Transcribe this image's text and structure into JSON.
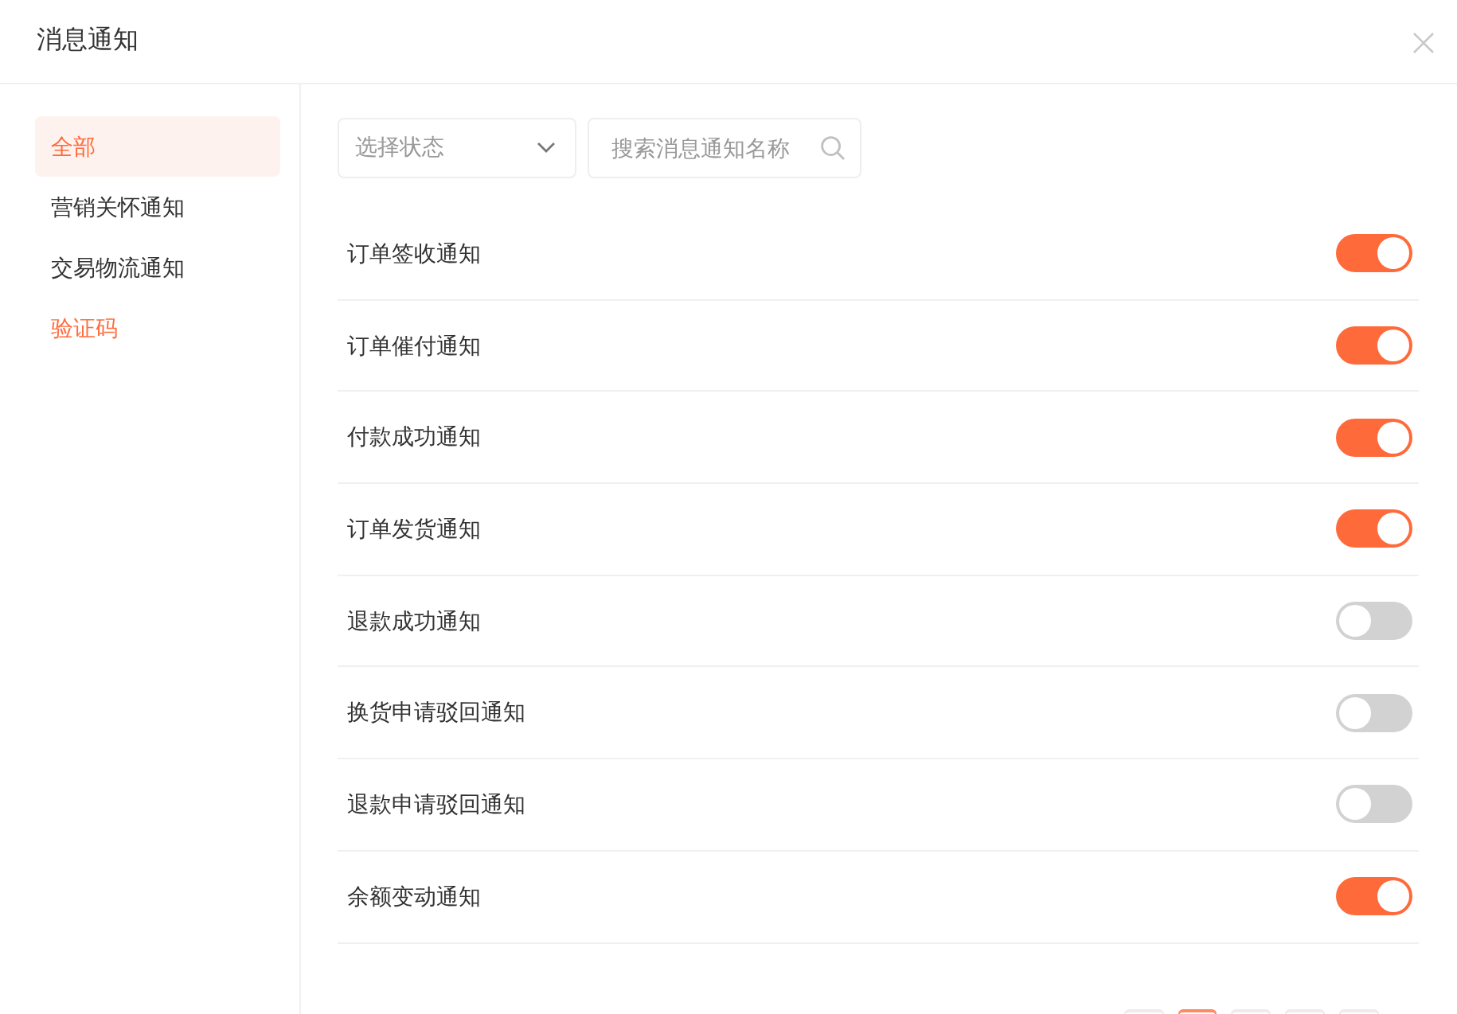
{
  "dialog": {
    "title": "消息通知"
  },
  "sidebar": {
    "items": [
      {
        "label": "全部",
        "selected": true,
        "hovered": false
      },
      {
        "label": "营销关怀通知",
        "selected": false,
        "hovered": false
      },
      {
        "label": "交易物流通知",
        "selected": false,
        "hovered": false
      },
      {
        "label": "验证码",
        "selected": false,
        "hovered": true
      }
    ]
  },
  "filters": {
    "status_select": {
      "placeholder": "选择状态"
    },
    "search": {
      "placeholder": "搜索消息通知名称"
    }
  },
  "notifications": [
    {
      "name": "订单签收通知",
      "on": true
    },
    {
      "name": "订单催付通知",
      "on": true
    },
    {
      "name": "付款成功通知",
      "on": true
    },
    {
      "name": "订单发货通知",
      "on": true
    },
    {
      "name": "退款成功通知",
      "on": false
    },
    {
      "name": "换货申请驳回通知",
      "on": false
    },
    {
      "name": "退款申请驳回通知",
      "on": false
    },
    {
      "name": "余额变动通知",
      "on": true
    }
  ],
  "pagination": {
    "pages": [
      {
        "selected": false
      },
      {
        "selected": true
      },
      {
        "selected": false
      },
      {
        "selected": false
      },
      {
        "selected": false
      }
    ]
  }
}
